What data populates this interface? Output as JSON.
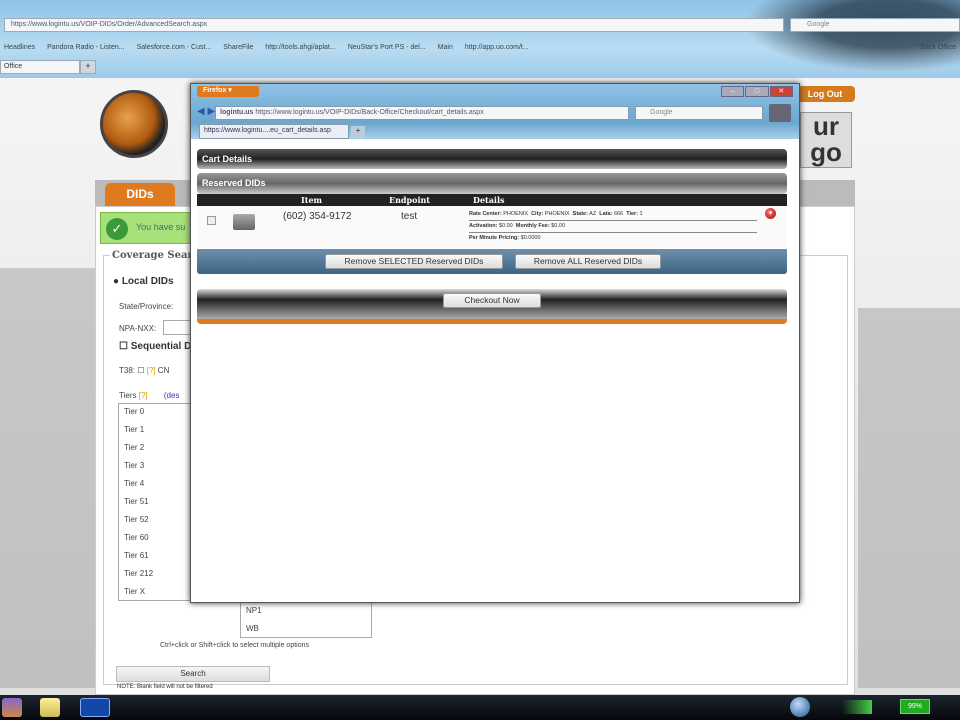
{
  "browser": {
    "url": "https://www.logintu.us/VOIP-DIDs/Order/AdvancedSearch.aspx",
    "search_placeholder": "Google",
    "bookmarks": [
      "Headlines",
      "Pandora Radio - Listen...",
      "Salesforce.com - Cust...",
      "ShareFile",
      "http://tools.ahgi/aplat...",
      "NeuStar's Port PS - del...",
      "Main",
      "http://app.uo.com/t...",
      "Back Office"
    ],
    "tab": "Office",
    "new_tab": "+"
  },
  "site": {
    "logout": "Log Out",
    "brand_text": "ur go",
    "tabs": {
      "dids": "DIDs"
    },
    "success_message": "You have su",
    "coverage_legend": "Coverage Searc",
    "local_dids": "Local DIDs",
    "state_label": "State/Province:",
    "npa_label": "NPA-NXX:",
    "sequential_label": "Sequential D",
    "t38_label": "T38:",
    "help_marker": "[?]",
    "cn_label": "CN",
    "tiers_label": "Tiers",
    "tiers_link": "(des",
    "tiers": [
      "Tier 0",
      "Tier 1",
      "Tier 2",
      "Tier 3",
      "Tier 4",
      "Tier 51",
      "Tier 52",
      "Tier 60",
      "Tier 61",
      "Tier 212",
      "Tier X"
    ],
    "npa_options": [
      "NP1",
      "WB"
    ],
    "multi_select_hint": "Ctrl+click or Shift+click to select multiple options",
    "search_button": "Search",
    "note": "NOTE: Blank field will not be filtered"
  },
  "popup": {
    "firefox_button": "Firefox ▾",
    "site_badge": "logintu.us",
    "url": "https://www.logintu.us/VOIP-DIDs/Back-Office/Checkout/cart_details.aspx",
    "search_placeholder": "Google",
    "tab": "https://www.logintu....eu_cart_details.asp",
    "new_tab": "+",
    "window_controls": [
      "–",
      "□",
      "✕"
    ],
    "cart_title": "Cart Details",
    "reserved_title": "Reserved DIDs",
    "columns": {
      "item": "Item",
      "endpoint": "Endpoint",
      "details": "Details"
    },
    "row": {
      "number": "(602) 354-9172",
      "endpoint": "test",
      "details": {
        "rate_center_label": "Rate Center:",
        "rate_center": "PHOENIX",
        "city_label": "City:",
        "city": "PHOENIX",
        "state_label": "State:",
        "state": "AZ",
        "lata_label": "Lata:",
        "lata": "666",
        "tier_label": "Tier:",
        "tier": "1",
        "activation_label": "Activation:",
        "activation": "$0.00",
        "monthly_label": "Monthly Fee:",
        "monthly": "$0.00",
        "per_minute_label": "Per Minute Pricing:",
        "per_minute": "$0.0000"
      }
    },
    "remove_selected": "Remove SELECTED Reserved DIDs",
    "remove_all": "Remove ALL Reserved DIDs",
    "checkout": "Checkout Now"
  },
  "taskbar": {
    "battery": "99%"
  }
}
